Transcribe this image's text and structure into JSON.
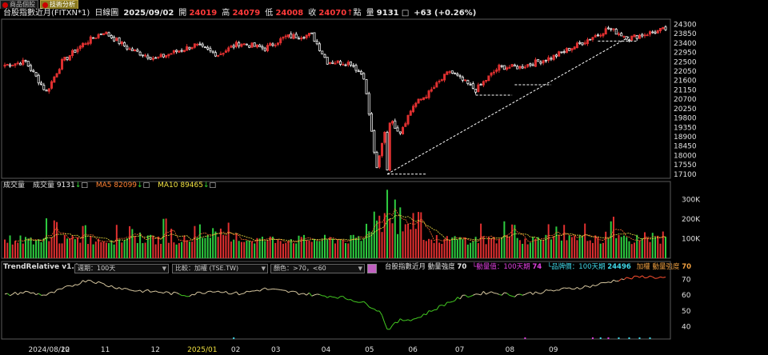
{
  "tabs": [
    {
      "label": "商品個股",
      "active": false
    },
    {
      "label": "技術分析",
      "active": true
    }
  ],
  "header": {
    "symbol": "台股指數近月(FITXN*1)",
    "chart_kind": "日線圖",
    "date": "2025/09/02",
    "open_label": "開",
    "open": "24019",
    "high_label": "高",
    "high": "24079",
    "low_label": "低",
    "low": "24008",
    "close_label": "收",
    "close": "24070",
    "change_label": "點",
    "volume_label": "量",
    "volume": "9131",
    "change": "+63 (+0.26%)"
  },
  "volume_header": {
    "title": "成交量",
    "vol_label": "成交量",
    "vol": "9131",
    "ma5_label": "MA5",
    "ma5": "82099",
    "ma10_label": "MA10",
    "ma10": "89465"
  },
  "indicator_header": {
    "title": "TrendRelative v1.0",
    "period": "週期：100天",
    "compare": "比較：加權 (TSE.TW)",
    "color": "顏色：>70，<60",
    "item1": "台股指數近月 動量強度",
    "item1_val": "70",
    "item2": "動量值：100天期",
    "item2_val": "74",
    "item3": "品牌價：100天期",
    "item3_val": "24496",
    "item4": "加權 動量強度",
    "item4_val": "70"
  },
  "colors": {
    "up": "#e03030",
    "down": "#2ecc40",
    "background": "#000000",
    "grid": "#333333",
    "trend": "#ffffff",
    "ma5": "#ff7030",
    "ma10": "#f0e040",
    "ind_mid": "#d8c8a0",
    "ind_high": "#ff5030",
    "ind_low": "#44cc22"
  },
  "chart_data": [
    {
      "type": "candlestick",
      "title": "台股指數近月(FITXN*1)",
      "ylim": [
        16900,
        24550
      ],
      "y_ticks": [
        24300,
        23850,
        23400,
        22950,
        22500,
        22050,
        21600,
        21150,
        20700,
        20250,
        19800,
        19350,
        18900,
        18450,
        18000,
        17550,
        17100
      ],
      "x_labels": [
        "2024/08/22",
        "10",
        "11",
        "12",
        "2025/01",
        "02",
        "03",
        "04",
        "05",
        "06",
        "07",
        "08",
        "09"
      ],
      "ohlc_control_points": [
        {
          "x": "2024/08/22",
          "close": 22350
        },
        {
          "x": "2024/09",
          "close": 22500
        },
        {
          "x": "2024/09 early",
          "close": 21050
        },
        {
          "x": "2024/09 mid",
          "close": 22500
        },
        {
          "x": "2024/10",
          "close": 23350
        },
        {
          "x": "2024/10 mid",
          "close": 23950
        },
        {
          "x": "2024/11",
          "close": 23100
        },
        {
          "x": "2024/11 mid",
          "close": 22650
        },
        {
          "x": "2024/12",
          "close": 23000
        },
        {
          "x": "2024/12 mid",
          "close": 23300
        },
        {
          "x": "2025/01",
          "close": 22850
        },
        {
          "x": "2025/01 mid",
          "close": 23400
        },
        {
          "x": "2025/02",
          "close": 23150
        },
        {
          "x": "2025/02 mid",
          "close": 23700
        },
        {
          "x": "2025/03",
          "close": 23800
        },
        {
          "x": "2025/03 mid",
          "close": 22500
        },
        {
          "x": "2025/03 late",
          "close": 22450
        },
        {
          "x": "2025/04",
          "close": 21800
        },
        {
          "x": "2025/04 low",
          "close": 17300
        },
        {
          "x": "2025/04 mid",
          "close": 19800
        },
        {
          "x": "2025/04 late",
          "close": 19150
        },
        {
          "x": "2025/05",
          "close": 20400
        },
        {
          "x": "2025/05 mid",
          "close": 21000
        },
        {
          "x": "2025/06",
          "close": 22050
        },
        {
          "x": "2025/06 mid",
          "close": 21150
        },
        {
          "x": "2025/06 late",
          "close": 22250
        },
        {
          "x": "2025/07",
          "close": 22250
        },
        {
          "x": "2025/07 mid",
          "close": 22700
        },
        {
          "x": "2025/08",
          "close": 23300
        },
        {
          "x": "2025/08 mid",
          "close": 24100
        },
        {
          "x": "2025/08 late",
          "close": 23650
        },
        {
          "x": "2025/09",
          "close": 24070
        }
      ],
      "trendline": {
        "from": {
          "x": "2025/04 low",
          "y": 17100
        },
        "to": {
          "x": "2025/08",
          "y": 23700
        }
      }
    },
    {
      "type": "bar",
      "title": "成交量",
      "ylim": [
        0,
        380000
      ],
      "y_ticks": [
        "300K",
        "200K",
        "100K"
      ],
      "series": [
        {
          "name": "MA5",
          "value": "82099"
        },
        {
          "name": "MA10",
          "value": "89465"
        }
      ]
    },
    {
      "type": "line",
      "title": "TrendRelative v1.0",
      "ylim": [
        32,
        78
      ],
      "y_ticks": [
        70,
        60,
        50,
        40
      ]
    }
  ]
}
